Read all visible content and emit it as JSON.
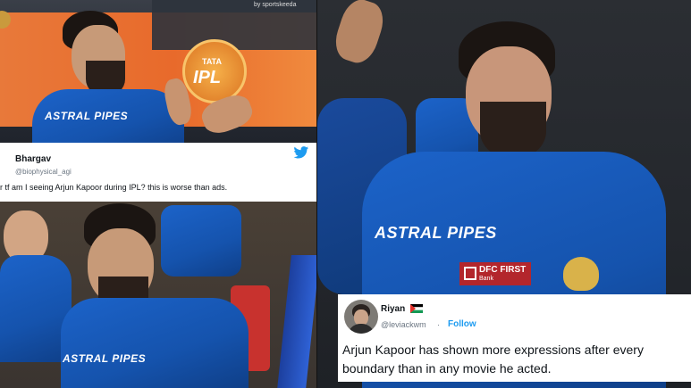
{
  "top_left_photo": {
    "watermark": "by sportskeeda",
    "jersey_sponsor": "ASTRAL PIPES",
    "ipl_logo_top": "TATA",
    "ipl_logo_text": "IPL"
  },
  "tweet_top": {
    "name": "Bhargav",
    "handle": "@biophysical_agi",
    "text": "r tf am I seeing Arjun Kapoor during IPL? this is worse than ads.",
    "icon": "twitter-bird-icon",
    "icon_color": "#1d9bf0"
  },
  "bottom_left_photo": {
    "jersey_sponsor": "ASTRAL PIPES"
  },
  "right_photo": {
    "jersey_sponsor": "ASTRAL PIPES",
    "bank_label": "DFC FIRST",
    "bank_sub": "Bank"
  },
  "tweet_bottom": {
    "name": "Riyan",
    "flag_icon": "palestine-flag-icon",
    "handle": "@leviackwm",
    "separator": "·",
    "follow_label": "Follow",
    "follow_color": "#1d9bf0",
    "text": "Arjun Kapoor has shown more expressions after every boundary than in any movie he acted."
  }
}
